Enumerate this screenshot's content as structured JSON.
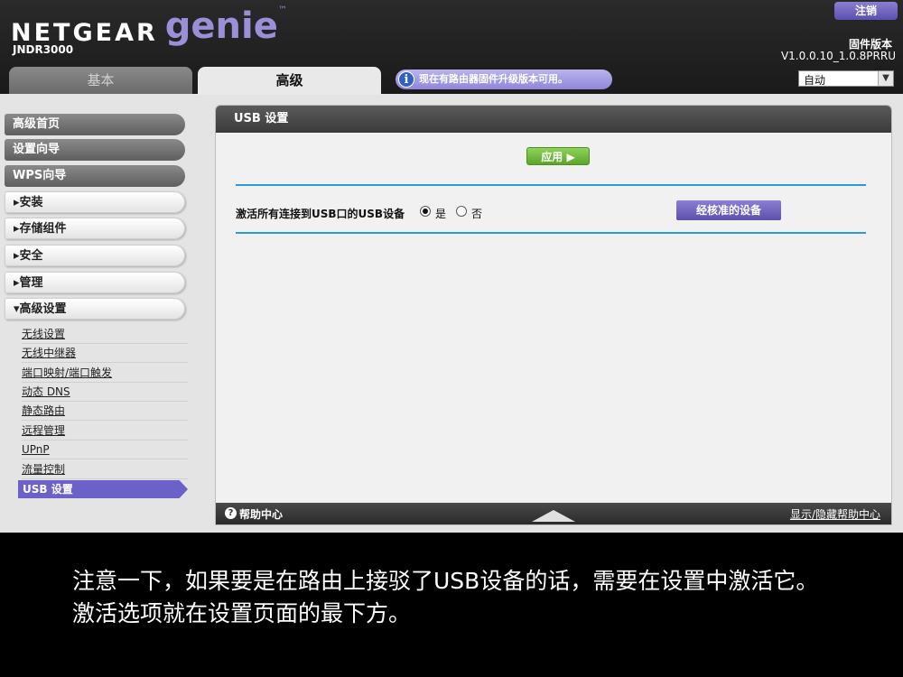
{
  "header": {
    "brand_netgear": "NETGEAR",
    "brand_genie": "genie",
    "trademark": "™",
    "model": "JNDR3000",
    "logout_label": "注销",
    "firmware_label": "固件版本",
    "firmware_version": "V1.0.0.10_1.0.8PRRU",
    "firmware_notice": "现在有路由器固件升级版本可用。",
    "language_selected": "自动"
  },
  "tabs": [
    {
      "label": "基本",
      "active": false
    },
    {
      "label": "高级",
      "active": true
    }
  ],
  "sidebar": {
    "items": [
      {
        "label": "高级首页"
      },
      {
        "label": "设置向导"
      },
      {
        "label": "WPS向导"
      },
      {
        "label": "▸安装"
      },
      {
        "label": "▸存储组件"
      },
      {
        "label": "▸安全"
      },
      {
        "label": "▸管理"
      },
      {
        "label": "▾高级设置"
      }
    ],
    "subitems": [
      {
        "label": "无线设置"
      },
      {
        "label": "无线中继器"
      },
      {
        "label": "端口映射/端口触发"
      },
      {
        "label": "动态 DNS"
      },
      {
        "label": "静态路由"
      },
      {
        "label": "远程管理"
      },
      {
        "label": "UPnP"
      },
      {
        "label": "流量控制"
      },
      {
        "label": "USB 设置",
        "active": true
      }
    ]
  },
  "main": {
    "title": "USB 设置",
    "apply_label": "应用 ▶",
    "usb_question": "激活所有连接到USB口的USB设备",
    "option_yes": "是",
    "option_no": "否",
    "selected_option": "yes",
    "approved_devices_label": "经核准的设备"
  },
  "footer": {
    "help_center": "帮助中心",
    "toggle_help": "显示/隐藏帮助中心"
  },
  "caption": {
    "line1": "注意一下，如果要是在路由上接驳了USB设备的话，需要在设置中激活它。",
    "line2": "激活选项就在设置页面的最下方。"
  },
  "colors": {
    "accent_purple": "#6c61c8",
    "apply_green": "#6db83a",
    "divider_blue": "#2c9ad6",
    "header_dark": "#1f1f1f"
  }
}
